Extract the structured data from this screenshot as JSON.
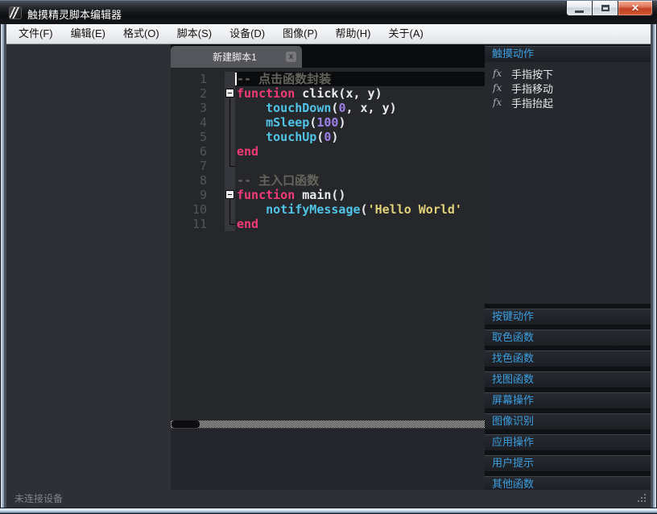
{
  "window": {
    "title": "触摸精灵脚本编辑器",
    "status_text": "未连接设备"
  },
  "menu": {
    "items": [
      "文件(F)",
      "编辑(E)",
      "格式(O)",
      "脚本(S)",
      "设备(D)",
      "图像(P)",
      "帮助(H)",
      "关于(A)"
    ]
  },
  "tabs": [
    {
      "label": "新建脚本1"
    }
  ],
  "icons": {
    "tab_close_glyph": "x",
    "close_button_glyph": "✕",
    "function_item_glyph": "fx"
  },
  "editor": {
    "lines": [
      {
        "n": "1",
        "current": true,
        "caret": true,
        "fold": "none",
        "tokens": [
          {
            "t": "-- 点击函数封装",
            "c": "comment"
          }
        ]
      },
      {
        "n": "2",
        "fold": "box",
        "tokens": [
          {
            "t": "function",
            "c": "keyword"
          },
          {
            "t": " click(x, y)",
            "c": "plain"
          }
        ]
      },
      {
        "n": "3",
        "fold": "line",
        "tokens": [
          {
            "t": "    ",
            "c": "plain"
          },
          {
            "t": "touchDown",
            "c": "func"
          },
          {
            "t": "(",
            "c": "plain"
          },
          {
            "t": "0",
            "c": "number"
          },
          {
            "t": ", x, y)",
            "c": "plain"
          }
        ]
      },
      {
        "n": "4",
        "fold": "line",
        "tokens": [
          {
            "t": "    ",
            "c": "plain"
          },
          {
            "t": "mSleep",
            "c": "func"
          },
          {
            "t": "(",
            "c": "plain"
          },
          {
            "t": "100",
            "c": "number"
          },
          {
            "t": ")",
            "c": "plain"
          }
        ]
      },
      {
        "n": "5",
        "fold": "line",
        "tokens": [
          {
            "t": "    ",
            "c": "plain"
          },
          {
            "t": "touchUp",
            "c": "func"
          },
          {
            "t": "(",
            "c": "plain"
          },
          {
            "t": "0",
            "c": "number"
          },
          {
            "t": ")",
            "c": "plain"
          }
        ]
      },
      {
        "n": "6",
        "fold": "line",
        "tokens": [
          {
            "t": "end",
            "c": "keyword"
          }
        ]
      },
      {
        "n": "7",
        "fold": "corner",
        "tokens": []
      },
      {
        "n": "8",
        "fold": "none",
        "tokens": [
          {
            "t": "-- 主入口函数",
            "c": "comment"
          }
        ]
      },
      {
        "n": "9",
        "fold": "box",
        "tokens": [
          {
            "t": "function",
            "c": "keyword"
          },
          {
            "t": " main()",
            "c": "plain"
          }
        ]
      },
      {
        "n": "10",
        "fold": "line",
        "tokens": [
          {
            "t": "    ",
            "c": "plain"
          },
          {
            "t": "notifyMessage",
            "c": "func"
          },
          {
            "t": "(",
            "c": "plain"
          },
          {
            "t": "'Hello World'",
            "c": "string"
          }
        ]
      },
      {
        "n": "11",
        "fold": "corner",
        "tokens": [
          {
            "t": "end",
            "c": "keyword"
          }
        ]
      }
    ]
  },
  "sidebar": {
    "panels": [
      {
        "label": "触摸动作",
        "expanded": true,
        "items": [
          {
            "icon": "fx",
            "label": "手指按下"
          },
          {
            "icon": "fx",
            "label": "手指移动"
          },
          {
            "icon": "fx",
            "label": "手指抬起"
          }
        ]
      },
      {
        "label": "按键动作"
      },
      {
        "label": "取色函数"
      },
      {
        "label": "找色函数"
      },
      {
        "label": "找图函数"
      },
      {
        "label": "屏幕操作"
      },
      {
        "label": "图像识别"
      },
      {
        "label": "应用操作"
      },
      {
        "label": "用户提示"
      },
      {
        "label": "其他函数"
      }
    ]
  },
  "colors": {
    "sidebar_accent": "#3b9fe0",
    "keyword": "#f23a76",
    "function_call": "#4fc4e7",
    "number": "#9d80e8",
    "string": "#e0d078",
    "comment": "#64655c",
    "editor_background": "#26272b",
    "close_button": "#c84a2e"
  }
}
